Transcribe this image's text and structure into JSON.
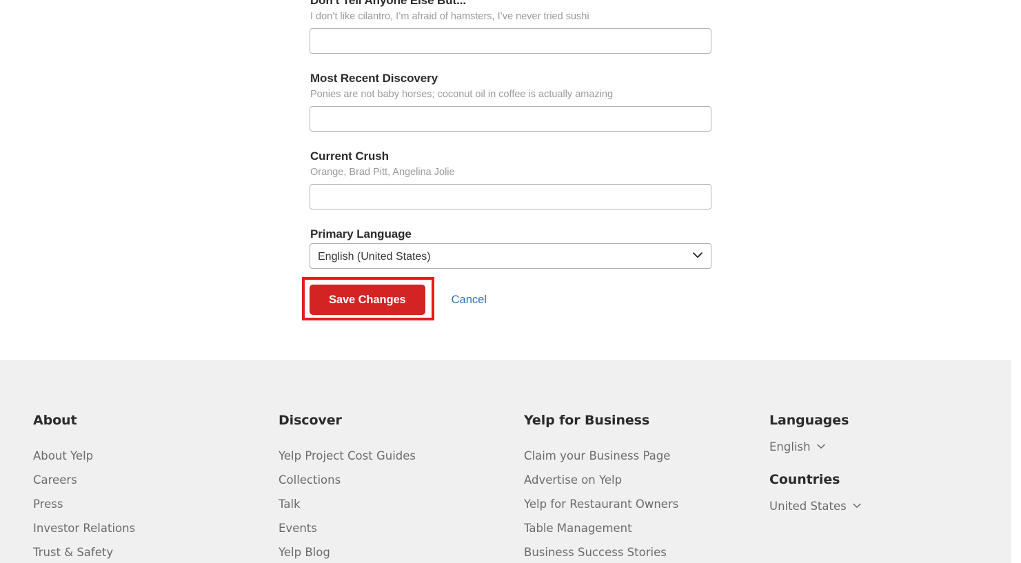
{
  "form": {
    "fields": [
      {
        "label": "Don't Tell Anyone Else But...",
        "hint": "I don’t like cilantro, I’m afraid of hamsters, I’ve never tried sushi",
        "value": "",
        "type": "text"
      },
      {
        "label": "Most Recent Discovery",
        "hint": "Ponies are not baby horses; coconut oil in coffee is actually amazing",
        "value": "",
        "type": "text"
      },
      {
        "label": "Current Crush",
        "hint": "Orange, Brad Pitt, Angelina Jolie",
        "value": "",
        "type": "text"
      },
      {
        "label": "Primary Language",
        "hint": "",
        "value": "English (United States)",
        "type": "select"
      }
    ],
    "actions": {
      "save_label": "Save Changes",
      "cancel_label": "Cancel"
    }
  },
  "icons": {
    "select_chevron": "⌄",
    "footer_chevron": "⌄"
  },
  "colors": {
    "brand_red": "#d32323",
    "annotation_red": "#e81b1b",
    "link_blue": "#2e73b1",
    "footer_bg": "#f0f0f0",
    "footer_link": "#6b6b6b"
  },
  "footer": {
    "columns": [
      {
        "heading": "About",
        "links": [
          "About Yelp",
          "Careers",
          "Press",
          "Investor Relations",
          "Trust & Safety"
        ]
      },
      {
        "heading": "Discover",
        "links": [
          "Yelp Project Cost Guides",
          "Collections",
          "Talk",
          "Events",
          "Yelp Blog"
        ]
      },
      {
        "heading": "Yelp for Business",
        "links": [
          "Claim your Business Page",
          "Advertise on Yelp",
          "Yelp for Restaurant Owners",
          "Table Management",
          "Business Success Stories"
        ]
      }
    ],
    "languages": {
      "heading": "Languages",
      "value": "English"
    },
    "countries": {
      "heading": "Countries",
      "value": "United States"
    }
  }
}
